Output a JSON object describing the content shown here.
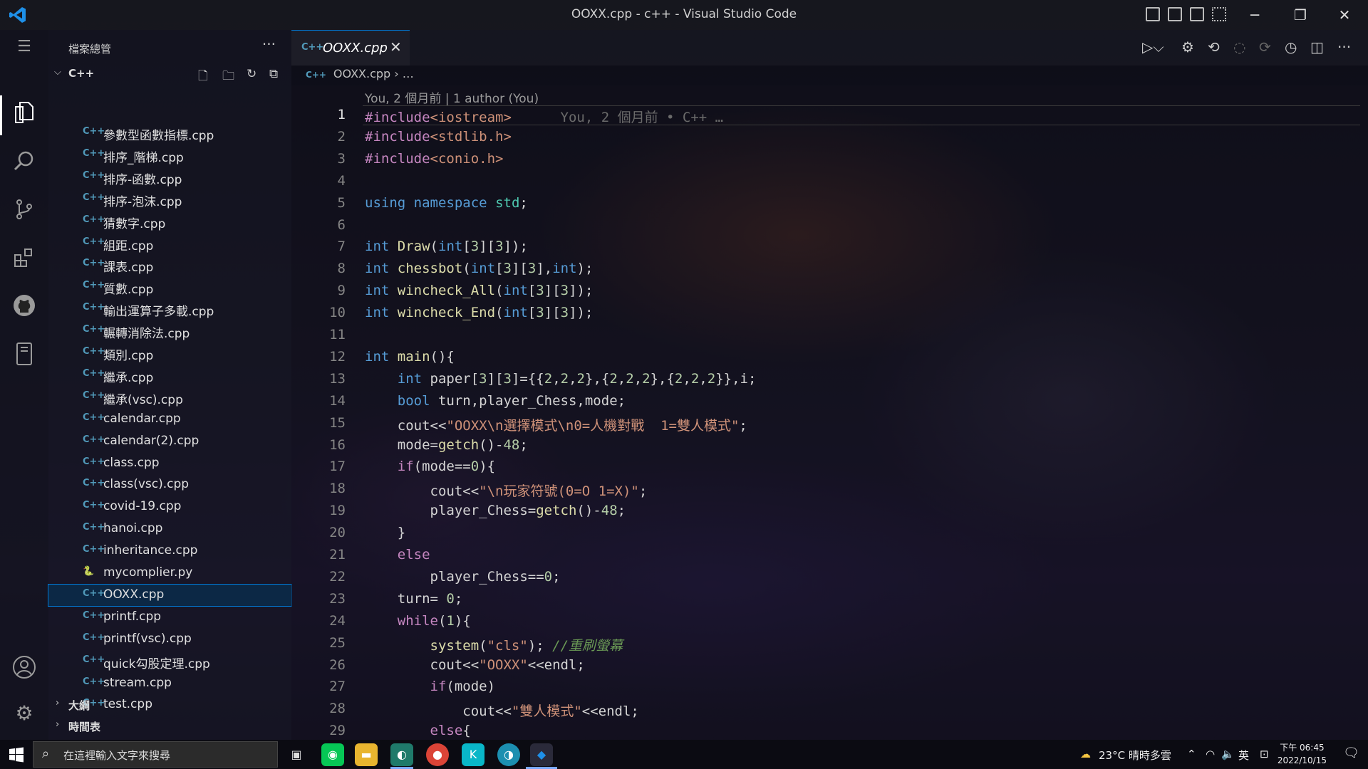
{
  "window": {
    "title": "OOXX.cpp - c++ - Visual Studio Code",
    "minimize": "─",
    "restore": "❐",
    "close": "✕"
  },
  "sidebar": {
    "title": "檔案總管",
    "more": "···",
    "folder": "C++",
    "files": [
      {
        "name": "參數型函數指標.cpp",
        "type": "cpp"
      },
      {
        "name": "排序_階梯.cpp",
        "type": "cpp"
      },
      {
        "name": "排序-函數.cpp",
        "type": "cpp"
      },
      {
        "name": "排序-泡沫.cpp",
        "type": "cpp"
      },
      {
        "name": "猜數字.cpp",
        "type": "cpp"
      },
      {
        "name": "組距.cpp",
        "type": "cpp"
      },
      {
        "name": "課表.cpp",
        "type": "cpp"
      },
      {
        "name": "質數.cpp",
        "type": "cpp"
      },
      {
        "name": "輸出運算子多載.cpp",
        "type": "cpp"
      },
      {
        "name": "輾轉消除法.cpp",
        "type": "cpp"
      },
      {
        "name": "類別.cpp",
        "type": "cpp"
      },
      {
        "name": "繼承.cpp",
        "type": "cpp"
      },
      {
        "name": "繼承(vsc).cpp",
        "type": "cpp"
      },
      {
        "name": "calendar.cpp",
        "type": "cpp"
      },
      {
        "name": "calendar(2).cpp",
        "type": "cpp"
      },
      {
        "name": "class.cpp",
        "type": "cpp"
      },
      {
        "name": "class(vsc).cpp",
        "type": "cpp"
      },
      {
        "name": "covid-19.cpp",
        "type": "cpp"
      },
      {
        "name": "hanoi.cpp",
        "type": "cpp"
      },
      {
        "name": "inheritance.cpp",
        "type": "cpp"
      },
      {
        "name": "mycomplier.py",
        "type": "py"
      },
      {
        "name": "OOXX.cpp",
        "type": "cpp",
        "selected": true
      },
      {
        "name": "printf.cpp",
        "type": "cpp"
      },
      {
        "name": "printf(vsc).cpp",
        "type": "cpp"
      },
      {
        "name": "quick勾股定理.cpp",
        "type": "cpp"
      },
      {
        "name": "stream.cpp",
        "type": "cpp"
      },
      {
        "name": "test.cpp",
        "type": "cpp"
      }
    ],
    "sections": [
      "大綱",
      "時間表"
    ]
  },
  "icons": {
    "cpp": "C++",
    "py": "🐍"
  },
  "tab": {
    "name": "OOXX.cpp",
    "close": "✕"
  },
  "breadcrumb": {
    "file": "OOXX.cpp",
    "rest": "› …"
  },
  "editor": {
    "blame": "You, 2 個月前 | 1 author (You)",
    "inline_blame": "You, 2 個月前 • C++ …",
    "current_line": 1,
    "lines": [
      [
        [
          "inc",
          "#include"
        ],
        [
          "str",
          "<iostream>"
        ]
      ],
      [
        [
          "inc",
          "#include"
        ],
        [
          "str",
          "<stdlib.h>"
        ]
      ],
      [
        [
          "inc",
          "#include"
        ],
        [
          "str",
          "<conio.h>"
        ]
      ],
      [],
      [
        [
          "kw",
          "using"
        ],
        [
          "op",
          " "
        ],
        [
          "kw",
          "namespace"
        ],
        [
          "op",
          " "
        ],
        [
          "ty",
          "std"
        ],
        [
          "op",
          ";"
        ]
      ],
      [],
      [
        [
          "kw",
          "int"
        ],
        [
          "op",
          " "
        ],
        [
          "fn",
          "Draw"
        ],
        [
          "op",
          "("
        ],
        [
          "kw",
          "int"
        ],
        [
          "op",
          "["
        ],
        [
          "num",
          "3"
        ],
        [
          "op",
          "]["
        ],
        [
          "num",
          "3"
        ],
        [
          "op",
          "]);"
        ]
      ],
      [
        [
          "kw",
          "int"
        ],
        [
          "op",
          " "
        ],
        [
          "fn",
          "chessbot"
        ],
        [
          "op",
          "("
        ],
        [
          "kw",
          "int"
        ],
        [
          "op",
          "["
        ],
        [
          "num",
          "3"
        ],
        [
          "op",
          "]["
        ],
        [
          "num",
          "3"
        ],
        [
          "op",
          "],"
        ],
        [
          "kw",
          "int"
        ],
        [
          "op",
          ");"
        ]
      ],
      [
        [
          "kw",
          "int"
        ],
        [
          "op",
          " "
        ],
        [
          "fn",
          "wincheck_All"
        ],
        [
          "op",
          "("
        ],
        [
          "kw",
          "int"
        ],
        [
          "op",
          "["
        ],
        [
          "num",
          "3"
        ],
        [
          "op",
          "]["
        ],
        [
          "num",
          "3"
        ],
        [
          "op",
          "]);"
        ]
      ],
      [
        [
          "kw",
          "int"
        ],
        [
          "op",
          " "
        ],
        [
          "fn",
          "wincheck_End"
        ],
        [
          "op",
          "("
        ],
        [
          "kw",
          "int"
        ],
        [
          "op",
          "["
        ],
        [
          "num",
          "3"
        ],
        [
          "op",
          "]["
        ],
        [
          "num",
          "3"
        ],
        [
          "op",
          "]);"
        ]
      ],
      [],
      [
        [
          "kw",
          "int"
        ],
        [
          "op",
          " "
        ],
        [
          "fn",
          "main"
        ],
        [
          "op",
          "(){"
        ]
      ],
      [
        [
          "op",
          "    "
        ],
        [
          "kw",
          "int"
        ],
        [
          "op",
          " paper["
        ],
        [
          "num",
          "3"
        ],
        [
          "op",
          "]["
        ],
        [
          "num",
          "3"
        ],
        [
          "op",
          "]={{"
        ],
        [
          "num",
          "2"
        ],
        [
          "op",
          ","
        ],
        [
          "num",
          "2"
        ],
        [
          "op",
          ","
        ],
        [
          "num",
          "2"
        ],
        [
          "op",
          "},{"
        ],
        [
          "num",
          "2"
        ],
        [
          "op",
          ","
        ],
        [
          "num",
          "2"
        ],
        [
          "op",
          ","
        ],
        [
          "num",
          "2"
        ],
        [
          "op",
          "},{"
        ],
        [
          "num",
          "2"
        ],
        [
          "op",
          ","
        ],
        [
          "num",
          "2"
        ],
        [
          "op",
          ","
        ],
        [
          "num",
          "2"
        ],
        [
          "op",
          "}},i;"
        ]
      ],
      [
        [
          "op",
          "    "
        ],
        [
          "kw",
          "bool"
        ],
        [
          "op",
          " turn,player_Chess,mode;"
        ]
      ],
      [
        [
          "op",
          "    cout<<"
        ],
        [
          "str",
          "\"OOXX\\n選擇模式\\n0=人機對戰  1=雙人模式\""
        ],
        [
          "op",
          ";"
        ]
      ],
      [
        [
          "op",
          "    mode="
        ],
        [
          "fn",
          "getch"
        ],
        [
          "op",
          "()-"
        ],
        [
          "num",
          "48"
        ],
        [
          "op",
          ";"
        ]
      ],
      [
        [
          "op",
          "    "
        ],
        [
          "inc",
          "if"
        ],
        [
          "op",
          "(mode=="
        ],
        [
          "num",
          "0"
        ],
        [
          "op",
          "){"
        ]
      ],
      [
        [
          "op",
          "        cout<<"
        ],
        [
          "str",
          "\"\\n玩家符號(0=O 1=X)\""
        ],
        [
          "op",
          ";"
        ]
      ],
      [
        [
          "op",
          "        player_Chess="
        ],
        [
          "fn",
          "getch"
        ],
        [
          "op",
          "()-"
        ],
        [
          "num",
          "48"
        ],
        [
          "op",
          ";"
        ]
      ],
      [
        [
          "op",
          "    }"
        ]
      ],
      [
        [
          "op",
          "    "
        ],
        [
          "inc",
          "else"
        ]
      ],
      [
        [
          "op",
          "        player_Chess=="
        ],
        [
          "num",
          "0"
        ],
        [
          "op",
          ";"
        ]
      ],
      [
        [
          "op",
          "    turn= "
        ],
        [
          "num",
          "0"
        ],
        [
          "op",
          ";"
        ]
      ],
      [
        [
          "op",
          "    "
        ],
        [
          "inc",
          "while"
        ],
        [
          "op",
          "("
        ],
        [
          "num",
          "1"
        ],
        [
          "op",
          "){"
        ]
      ],
      [
        [
          "op",
          "        "
        ],
        [
          "fn",
          "system"
        ],
        [
          "op",
          "("
        ],
        [
          "str",
          "\"cls\""
        ],
        [
          "op",
          ");"
        ],
        [
          "op",
          " "
        ],
        [
          "cm",
          "//重刷螢幕"
        ]
      ],
      [
        [
          "op",
          "        cout<<"
        ],
        [
          "str",
          "\"OOXX\""
        ],
        [
          "op",
          "<<endl;"
        ]
      ],
      [
        [
          "op",
          "        "
        ],
        [
          "inc",
          "if"
        ],
        [
          "op",
          "(mode)"
        ]
      ],
      [
        [
          "op",
          "            cout<<"
        ],
        [
          "str",
          "\"雙人模式\""
        ],
        [
          "op",
          "<<endl;"
        ]
      ],
      [
        [
          "op",
          "        "
        ],
        [
          "inc",
          "else"
        ],
        [
          "op",
          "{"
        ]
      ]
    ]
  },
  "taskbar": {
    "search_placeholder": "在這裡輸入文字來搜尋",
    "weather": "23°C 晴時多雲",
    "ime": "英",
    "time": "下午 06:45",
    "date": "2022/10/15"
  }
}
